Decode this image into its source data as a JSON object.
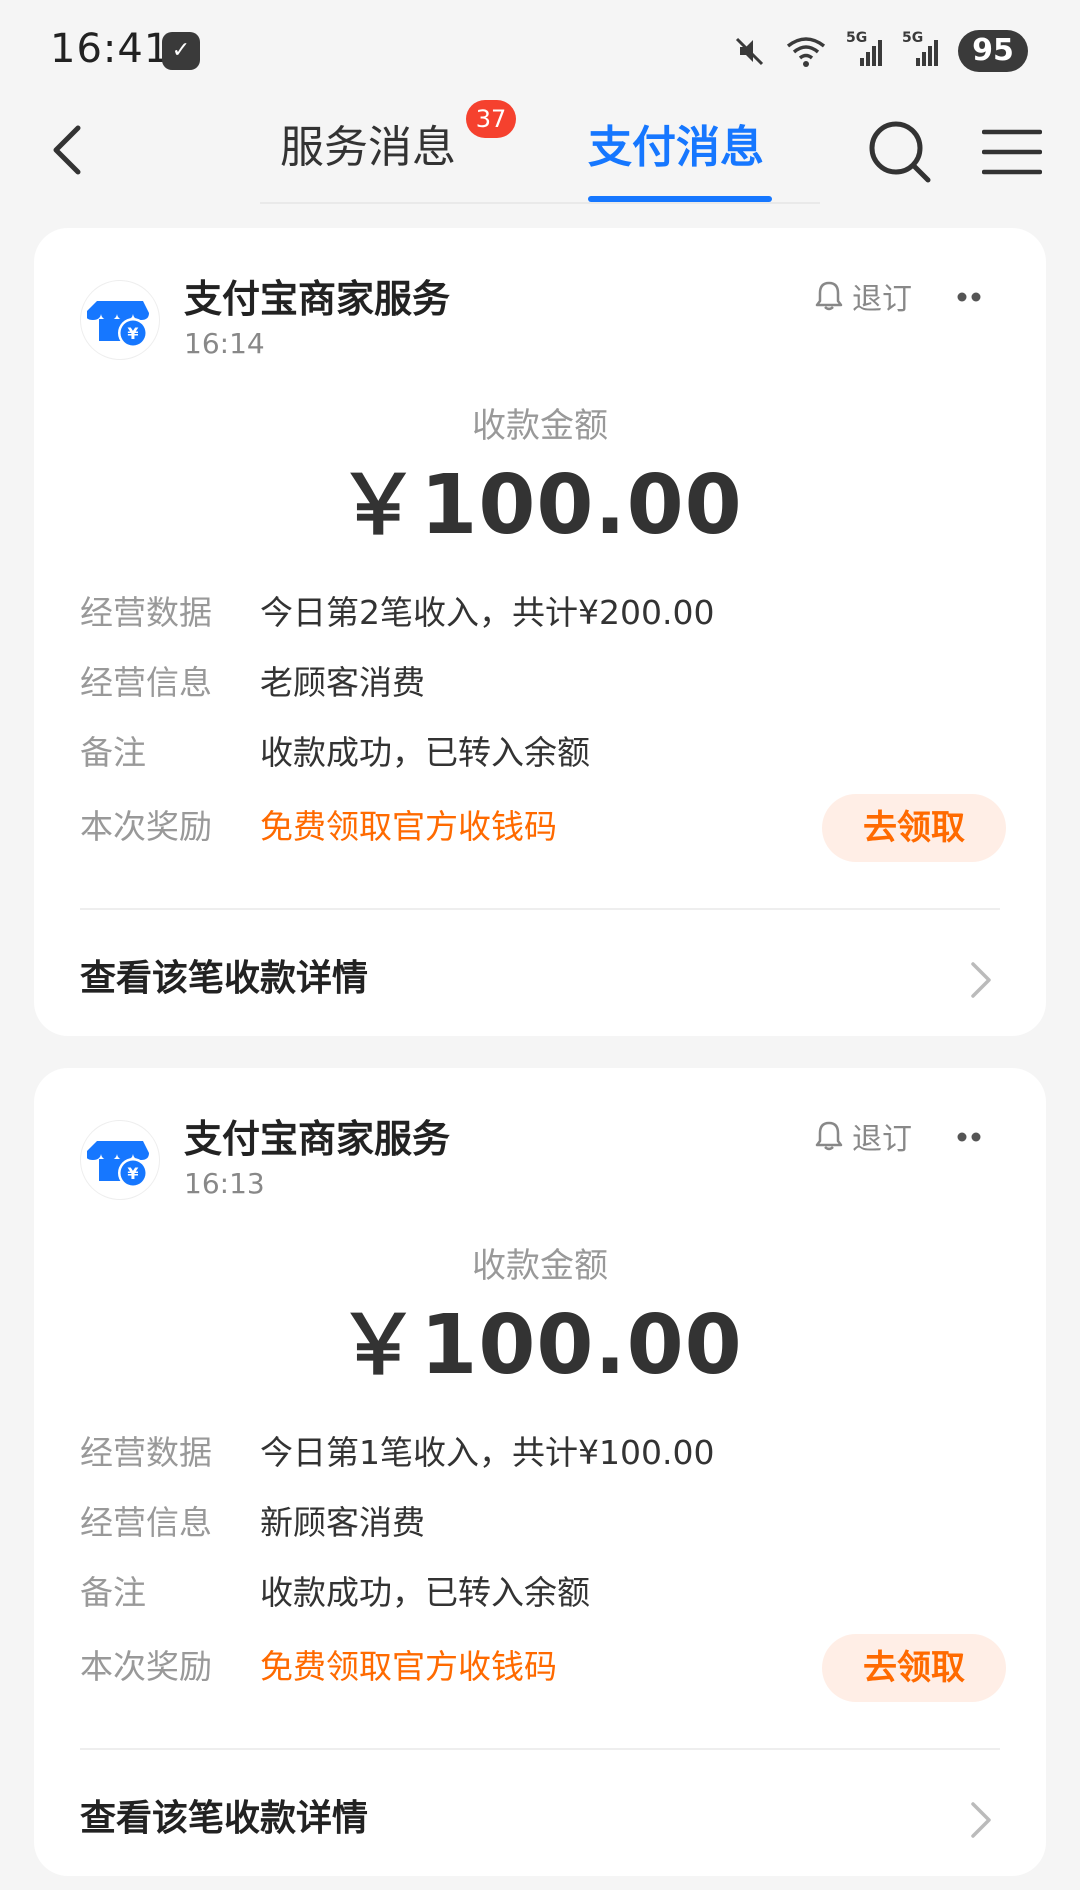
{
  "status_bar": {
    "time": "16:41",
    "battery": "95",
    "network_1": "5G",
    "network_2": "5G"
  },
  "header": {
    "tabs": [
      {
        "label": "服务消息",
        "badge": "37",
        "active": false
      },
      {
        "label": "支付消息",
        "active": true
      }
    ]
  },
  "colors": {
    "accent": "#1677ff",
    "badge": "#f5412e",
    "reward": "#ff6a00",
    "merchant_icon": "#1677ff"
  },
  "messages": [
    {
      "sender": "支付宝商家服务",
      "time": "16:14",
      "unsubscribe_label": "退订",
      "amount_label": "收款金额",
      "amount": "￥100.00",
      "rows": [
        {
          "label": "经营数据",
          "value": "今日第2笔收入，共计¥200.00"
        },
        {
          "label": "经营信息",
          "value": "老顾客消费"
        },
        {
          "label": "备注",
          "value": "收款成功，已转入余额"
        },
        {
          "label": "本次奖励",
          "value": "免费领取官方收钱码"
        }
      ],
      "claim_label": "去领取",
      "detail_label": "查看该笔收款详情"
    },
    {
      "sender": "支付宝商家服务",
      "time": "16:13",
      "unsubscribe_label": "退订",
      "amount_label": "收款金额",
      "amount": "￥100.00",
      "rows": [
        {
          "label": "经营数据",
          "value": "今日第1笔收入，共计¥100.00"
        },
        {
          "label": "经营信息",
          "value": "新顾客消费"
        },
        {
          "label": "备注",
          "value": "收款成功，已转入余额"
        },
        {
          "label": "本次奖励",
          "value": "免费领取官方收钱码"
        }
      ],
      "claim_label": "去领取",
      "detail_label": "查看该笔收款详情"
    }
  ]
}
